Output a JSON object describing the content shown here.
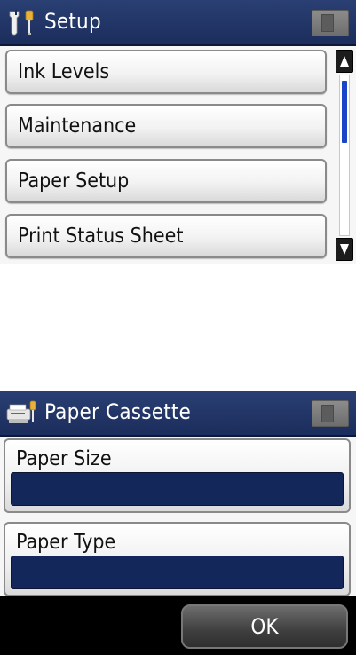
{
  "setup_screen": {
    "title": "Setup",
    "title_icon": "wrench-screwdriver-icon",
    "status_icon": "memory-card-icon",
    "items": [
      {
        "label": "Ink Levels"
      },
      {
        "label": "Maintenance"
      },
      {
        "label": "Paper Setup"
      },
      {
        "label": "Print Status Sheet"
      }
    ],
    "scrollbar": {
      "position_fraction": 0.0,
      "up_icon": "arrow-up-icon",
      "down_icon": "arrow-down-icon"
    }
  },
  "cassette_screen": {
    "title": "Paper Cassette",
    "title_icon": "printer-wrench-icon",
    "status_icon": "memory-card-icon",
    "fields": [
      {
        "label": "Paper Size",
        "value": ""
      },
      {
        "label": "Paper Type",
        "value": ""
      }
    ],
    "ok_label": "OK"
  },
  "colors": {
    "title_bar": "#1b2d5c",
    "field_value_bg": "#13275a",
    "scroll_thumb": "#1b45c9"
  }
}
